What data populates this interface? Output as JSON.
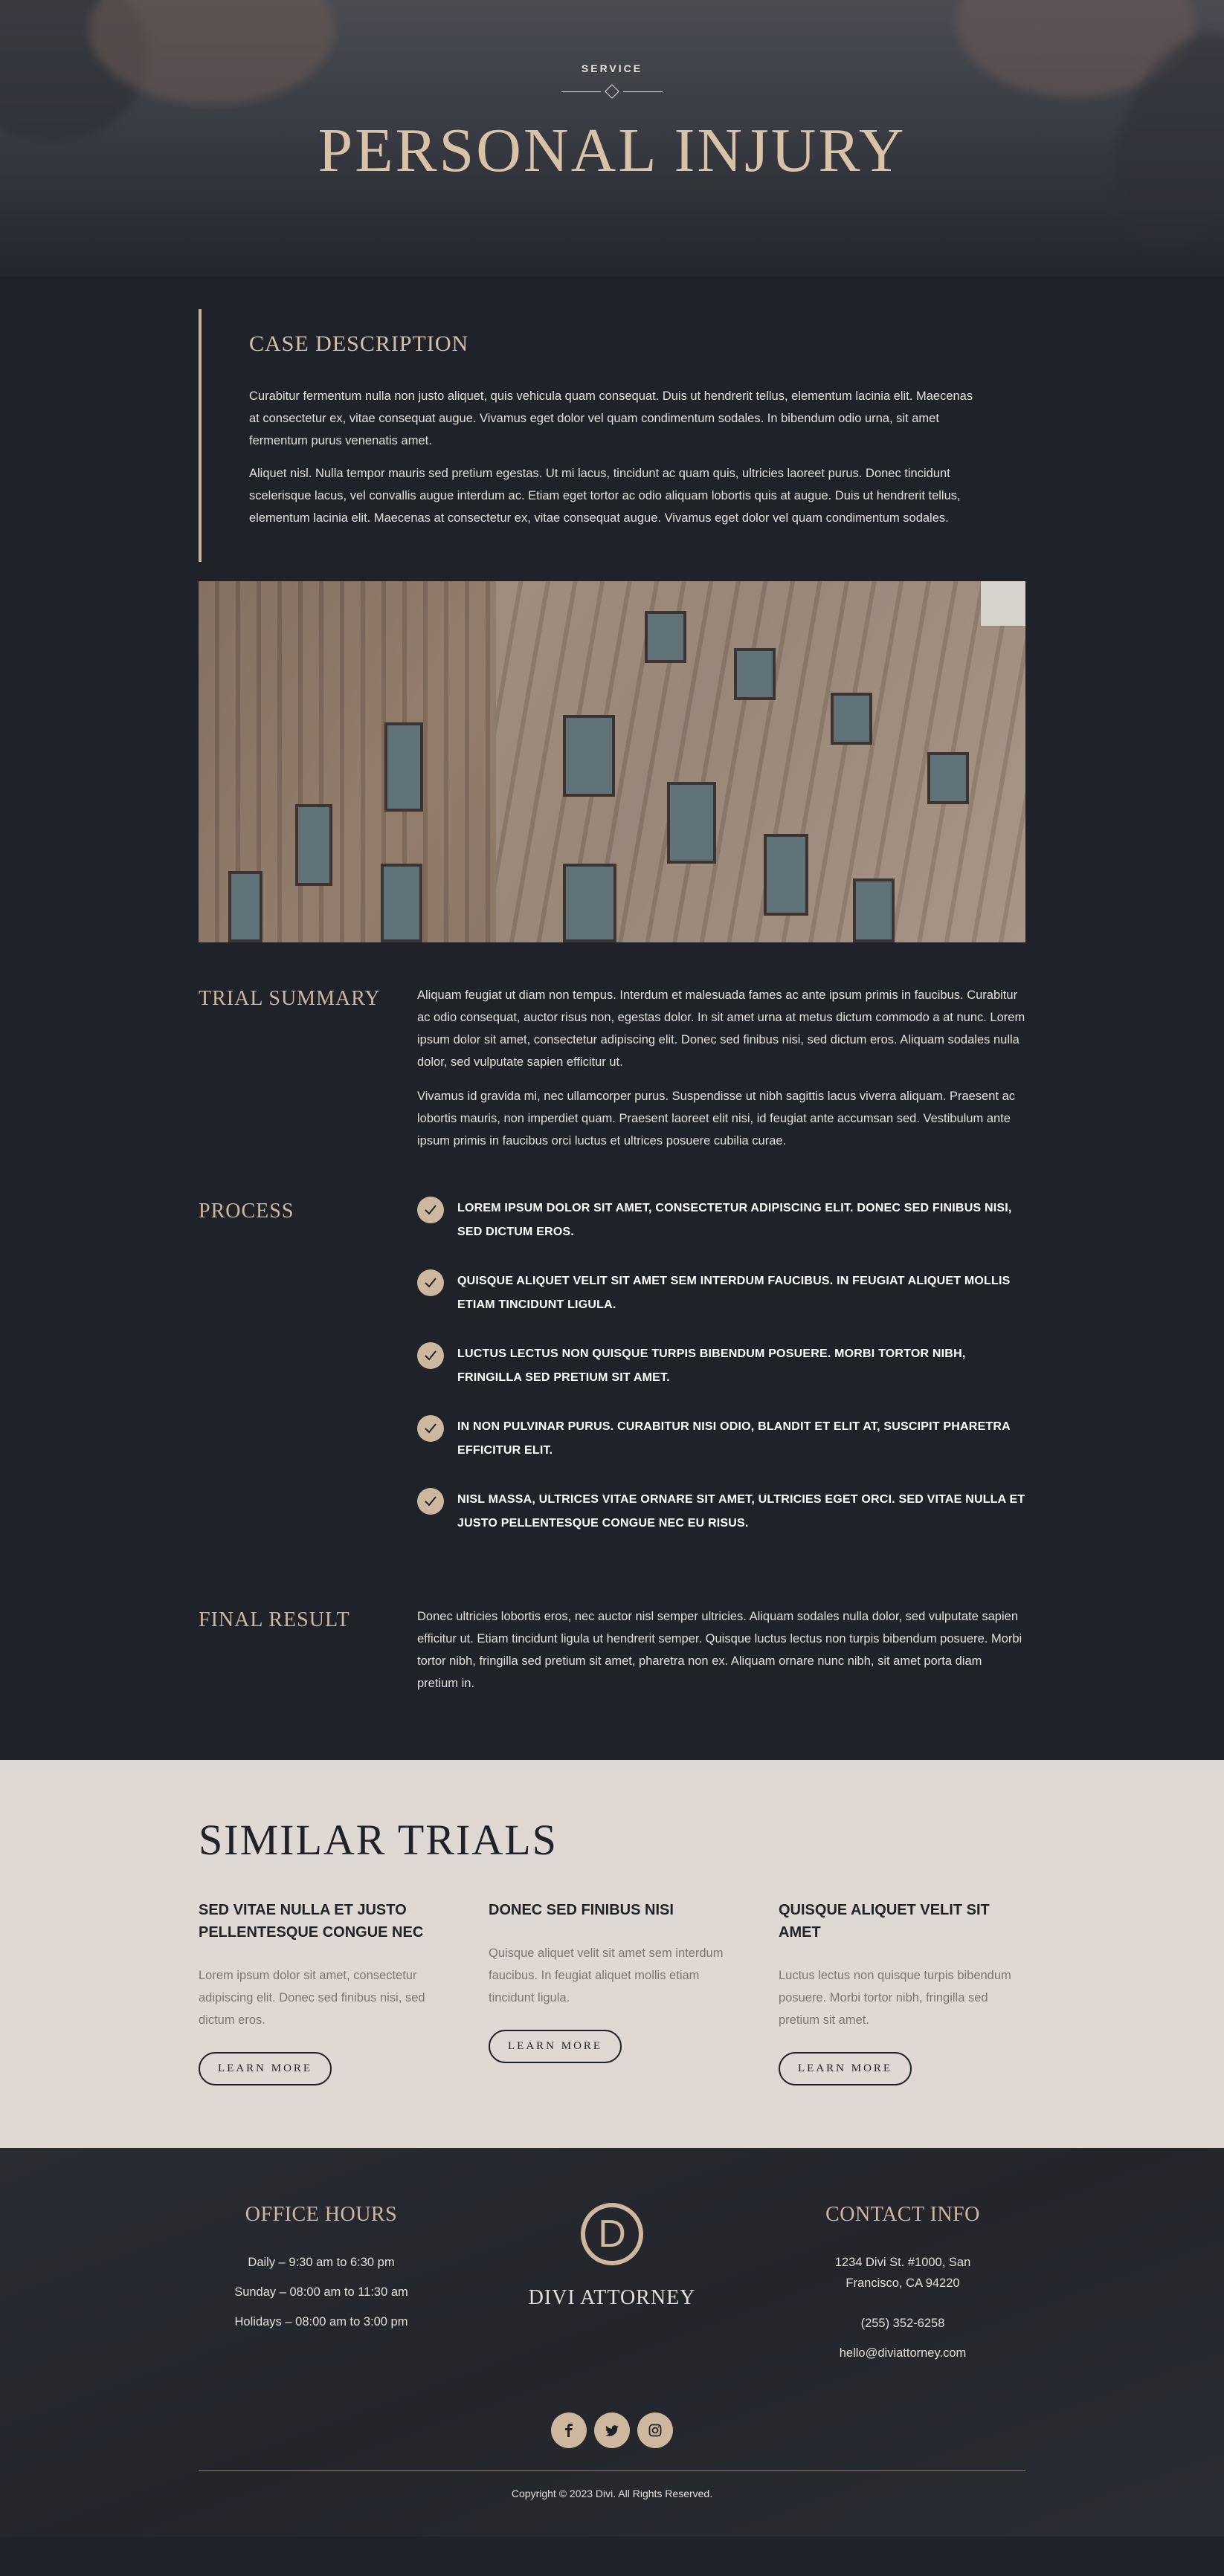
{
  "hero": {
    "eyebrow": "SERVICE",
    "title": "PERSONAL INJURY"
  },
  "case": {
    "heading": "CASE DESCRIPTION",
    "paragraphs": [
      "Curabitur fermentum nulla non justo aliquet, quis vehicula quam consequat. Duis ut hendrerit tellus, elementum lacinia elit. Maecenas at consectetur ex, vitae consequat augue. Vivamus eget dolor vel quam condimentum sodales. In bibendum odio urna, sit amet fermentum purus venenatis amet.",
      "Aliquet nisl. Nulla tempor mauris sed pretium egestas. Ut mi lacus, tincidunt ac quam quis, ultricies laoreet purus. Donec tincidunt scelerisque lacus, vel convallis augue interdum ac. Etiam eget tortor ac odio aliquam lobortis quis at augue. Duis ut hendrerit tellus, elementum lacinia elit. Maecenas at consectetur ex, vitae consequat augue. Vivamus eget dolor vel quam condimentum sodales."
    ]
  },
  "trial_summary": {
    "label": "TRIAL SUMMARY",
    "paragraphs": [
      "Aliquam feugiat ut diam non tempus. Interdum et malesuada fames ac ante ipsum primis in faucibus. Curabitur ac odio consequat, auctor risus non, egestas dolor. In sit amet urna at metus dictum commodo a at nunc. Lorem ipsum dolor sit amet, consectetur adipiscing elit. Donec sed finibus nisi, sed dictum eros. Aliquam sodales nulla dolor, sed vulputate sapien efficitur ut.",
      "Vivamus id gravida mi, nec ullamcorper purus. Suspendisse ut nibh sagittis lacus viverra aliquam. Praesent ac lobortis mauris, non imperdiet quam. Praesent laoreet elit nisi, id feugiat ante accumsan sed. Vestibulum ante ipsum primis in faucibus orci luctus et ultrices posuere cubilia curae."
    ]
  },
  "process": {
    "label": "PROCESS",
    "items": [
      "Lorem ipsum dolor sit amet, consectetur adipiscing elit. Donec sed finibus nisi, sed dictum eros.",
      "Quisque aliquet velit sit amet sem interdum faucibus. In feugiat aliquet mollis etiam tincidunt ligula.",
      "Luctus lectus non quisque turpis bibendum posuere. Morbi tortor nibh, fringilla sed pretium sit amet.",
      "In non pulvinar purus. Curabitur nisi odio, blandit et elit at, suscipit pharetra efficitur elit.",
      "Nisl massa, ultrices vitae ornare sit amet, ultricies eget orci. Sed vitae nulla et justo pellentesque congue nec eu risus."
    ]
  },
  "final_result": {
    "label": "FINAL RESULT",
    "paragraph": "Donec ultricies lobortis eros, nec auctor nisl semper ultricies. Aliquam sodales nulla dolor, sed vulputate sapien efficitur ut. Etiam tincidunt ligula ut hendrerit semper. Quisque luctus lectus non turpis bibendum posuere. Morbi tortor nibh, fringilla sed pretium sit amet, pharetra non ex. Aliquam ornare nunc nibh, sit amet porta diam pretium in."
  },
  "similar": {
    "heading": "SIMILAR TRIALS",
    "cards": [
      {
        "title": "SED VITAE NULLA ET JUSTO PELLENTESQUE CONGUE NEC",
        "text": "Lorem ipsum dolor sit amet, consectetur adipiscing elit. Donec sed finibus nisi, sed dictum eros.",
        "button": "LEARN MORE"
      },
      {
        "title": "DONEC SED FINIBUS NISI",
        "text": "Quisque aliquet velit sit amet sem interdum faucibus. In feugiat aliquet mollis etiam tincidunt ligula.",
        "button": "LEARN MORE"
      },
      {
        "title": "QUISQUE ALIQUET VELIT SIT AMET",
        "text": "Luctus lectus non quisque turpis bibendum posuere. Morbi tortor nibh, fringilla sed pretium sit amet.",
        "button": "LEARN MORE"
      }
    ]
  },
  "footer": {
    "office": {
      "heading": "OFFICE HOURS",
      "lines": [
        "Daily – 9:30 am to 6:30 pm",
        "Sunday – 08:00 am to 11:30 am",
        "Holidays – 08:00 am to 3:00 pm"
      ]
    },
    "brand": {
      "logo_letter": "D",
      "name": "DIVI ATTORNEY"
    },
    "contact": {
      "heading": "CONTACT INFO",
      "address": "1234 Divi St. #1000, San Francisco, CA 94220",
      "phone": "(255) 352-6258",
      "email": "hello@diviattorney.com"
    },
    "socials": [
      "facebook-icon",
      "twitter-icon",
      "instagram-icon"
    ],
    "copyright": "Copyright © 2023 Divi. All Rights Reserved."
  },
  "colors": {
    "background": "#1f2228",
    "accent": "#cdb79f",
    "light_section": "#e0d9d3"
  }
}
